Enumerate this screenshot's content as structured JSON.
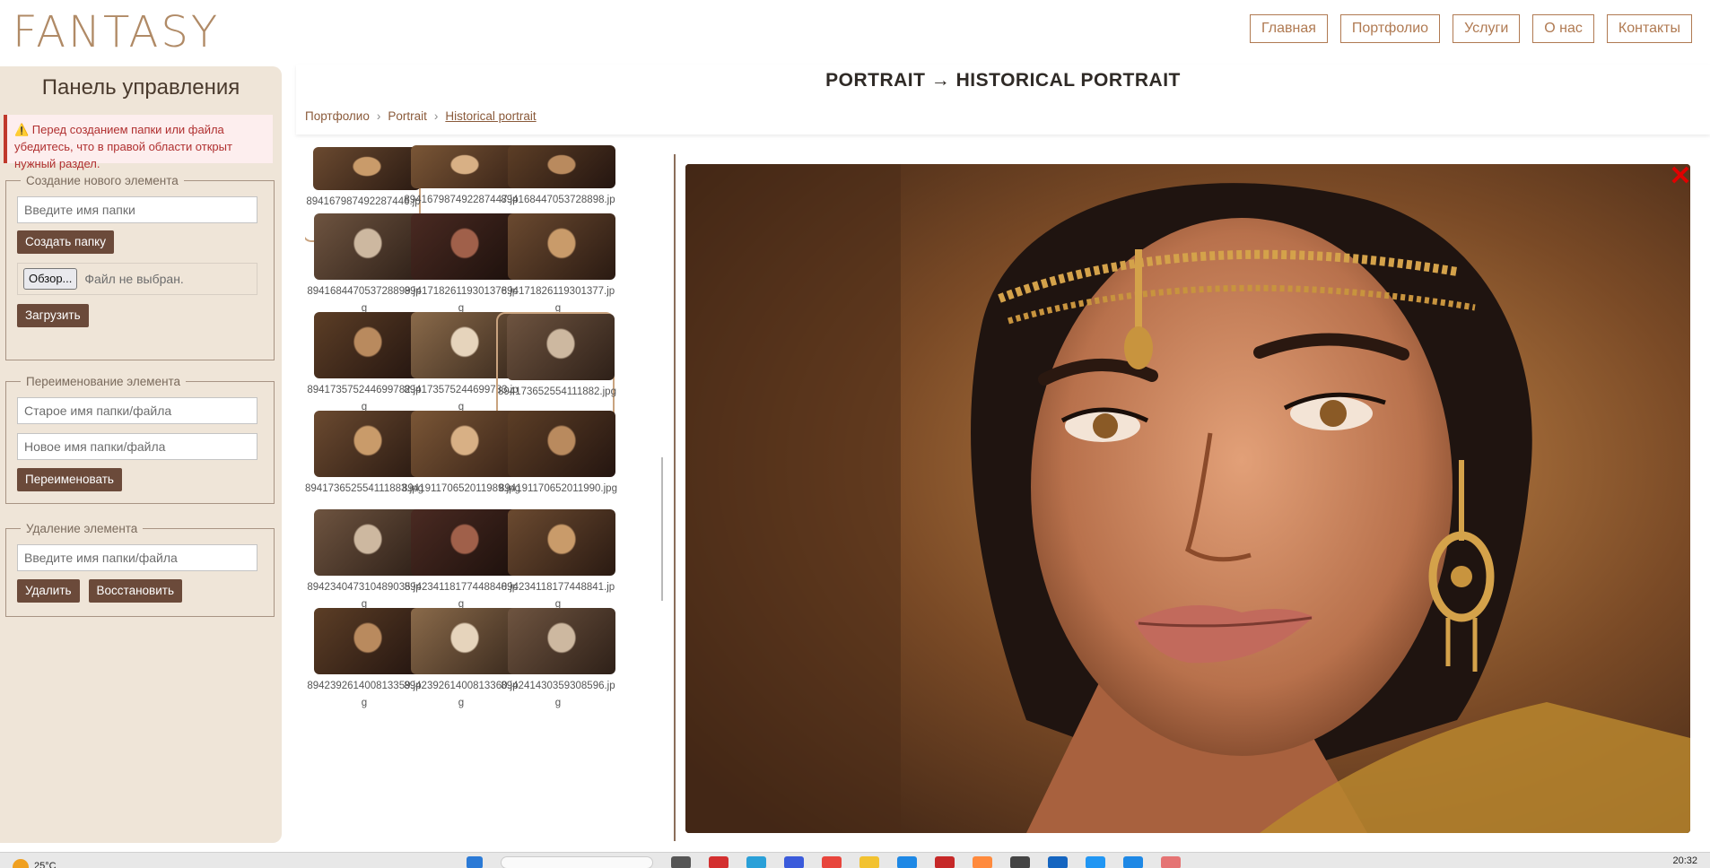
{
  "header": {
    "logo": "FANTASY",
    "nav": [
      "Главная",
      "Портфолио",
      "Услуги",
      "О нас",
      "Контакты"
    ]
  },
  "sidebar": {
    "title": "Панель управления",
    "warning": "⚠️ Перед созданием папки или файла убедитесь, что в правой области открыт нужный раздел.",
    "create": {
      "legend": "Создание нового элемента",
      "folder_placeholder": "Введите имя папки",
      "create_button": "Создать папку",
      "browse_button": "Обзор...",
      "no_file": "Файл не выбран.",
      "upload_button": "Загрузить"
    },
    "rename": {
      "legend": "Переименование элемента",
      "old_placeholder": "Старое имя папки/файла",
      "new_placeholder": "Новое имя папки/файла",
      "rename_button": "Переименовать"
    },
    "delete": {
      "legend": "Удаление элемента",
      "placeholder": "Введите имя папки/файла",
      "delete_button": "Удалить",
      "restore_button": "Восстановить"
    }
  },
  "content": {
    "title": "PORTRAIT → HISTORICAL PORTRAIT",
    "breadcrumb": [
      "Портфолио",
      "Portrait",
      "Historical portrait"
    ],
    "breadcrumb_sep": "›"
  },
  "gallery": {
    "thumbs": [
      {
        "name": "894167987492287446.jpg",
        "selected": true
      },
      {
        "name": "894167987492287447.jpg",
        "selected": false
      },
      {
        "name": "894168447053728898.jpg",
        "selected": false
      },
      {
        "name": "894168447053728899.jpg",
        "selected": false
      },
      {
        "name": "894171826119301376.jpg",
        "selected": false
      },
      {
        "name": "894171826119301377.jpg",
        "selected": false
      },
      {
        "name": "894173575244699782.jpg",
        "selected": false
      },
      {
        "name": "894173575244699783.jpg",
        "selected": false
      },
      {
        "name": "894173652554111882.jpg",
        "selected": true
      },
      {
        "name": "894173652554111883.jpg",
        "selected": false
      },
      {
        "name": "894191170652011989.jpg",
        "selected": false
      },
      {
        "name": "894191170652011990.jpg",
        "selected": false
      },
      {
        "name": "894234047310489035.jpg",
        "selected": false
      },
      {
        "name": "894234118177448840.jpg",
        "selected": false
      },
      {
        "name": "894234118177448841.jpg",
        "selected": false
      },
      {
        "name": "894239261400813359.jpg",
        "selected": false
      },
      {
        "name": "894239261400813360.jpg",
        "selected": false
      },
      {
        "name": "894241430359308596.jpg",
        "selected": false
      }
    ]
  },
  "viewer": {
    "close_icon": "close-icon",
    "close_glyph": "✕"
  },
  "taskbar": {
    "weather": "25°C",
    "clock": "20:32"
  },
  "colors": {
    "accent": "#6b4a3a",
    "nav_border": "#b07a52",
    "sidebar_bg": "#efe5d8",
    "selected_border": "#c9a37f",
    "close": "#e10000"
  }
}
